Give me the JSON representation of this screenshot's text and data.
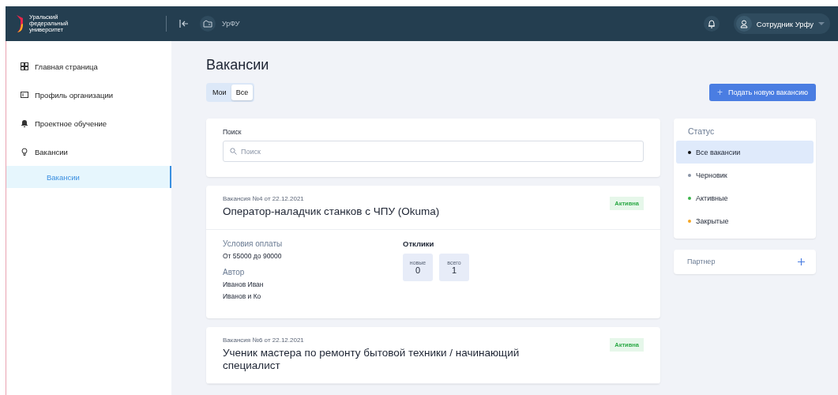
{
  "header": {
    "logo_lines": [
      "Уральский",
      "федеральный",
      "университет"
    ],
    "org": "УрФУ",
    "user": "Сотрудник Урфу"
  },
  "sidebar": {
    "items": [
      {
        "label": "Главная страница",
        "selected": false
      },
      {
        "label": "Профиль организации",
        "selected": false
      },
      {
        "label": "Проектное обучение",
        "selected": false
      },
      {
        "label": "Вакансии",
        "selected": false,
        "children": [
          {
            "label": "Вакансии",
            "selected": true
          }
        ]
      }
    ]
  },
  "page": {
    "title": "Вакансии",
    "tabs": [
      {
        "label": "Мои",
        "selected": false
      },
      {
        "label": "Все",
        "selected": true
      }
    ],
    "new_button": "Подать новую вакансию",
    "new_button_icon": "+"
  },
  "search": {
    "label": "Поиск",
    "placeholder": "Поиск"
  },
  "vacancies": [
    {
      "meta": "Вакансия №4 от 22.12.2021",
      "title": "Оператор-наладчик станков с ЧПУ (Okuma)",
      "status": "Активна",
      "pay_label": "Условия оплаты",
      "pay": "От 55000 до 90000",
      "author_label": "Автор",
      "author": [
        "Иванов Иван",
        "Иванов и Ко"
      ],
      "responses_label": "Отклики",
      "counters": [
        {
          "label": "новые",
          "value": "0"
        },
        {
          "label": "всего",
          "value": "1"
        }
      ]
    },
    {
      "meta": "Вакансия №6 от 22.12.2021",
      "title": "Ученик мастера по ремонту бытовой техники / начинающий специалист",
      "status": "Активна"
    }
  ],
  "filters": {
    "title": "Статус",
    "items": [
      {
        "label": "Все вакансии",
        "color": "#111111",
        "selected": true
      },
      {
        "label": "Черновик",
        "color": "#8a94a6",
        "selected": false
      },
      {
        "label": "Активные",
        "color": "#3cb54a",
        "selected": false
      },
      {
        "label": "Закрытые",
        "color": "#f5a623",
        "selected": false
      }
    ],
    "partner": "Партнер"
  }
}
